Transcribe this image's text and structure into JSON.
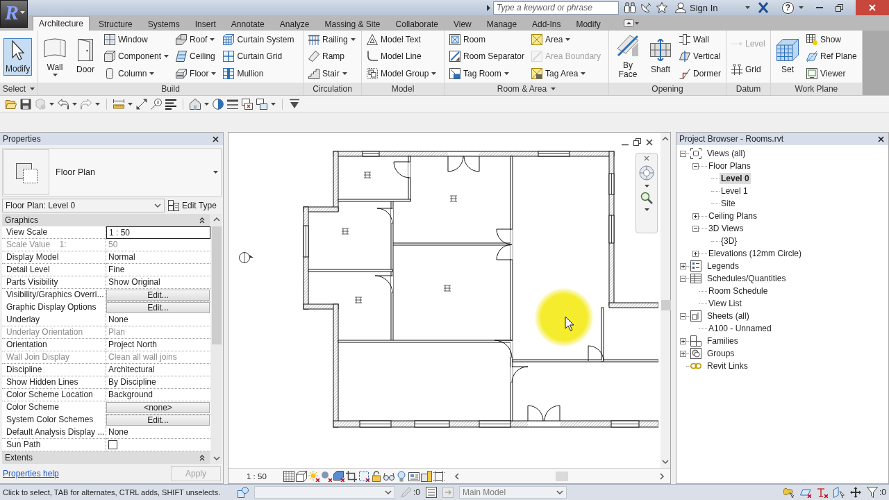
{
  "app_menu": {
    "logo": "R"
  },
  "title_bar": {
    "search": {
      "placeholder": "Type a keyword or phrase"
    },
    "sign_in": "Sign In",
    "help": "?"
  },
  "tabs": [
    {
      "label": "Architecture",
      "selected": true
    },
    {
      "label": "Structure",
      "selected": false
    },
    {
      "label": "Systems",
      "selected": false
    },
    {
      "label": "Insert",
      "selected": false
    },
    {
      "label": "Annotate",
      "selected": false
    },
    {
      "label": "Analyze",
      "selected": false
    },
    {
      "label": "Massing & Site",
      "selected": false
    },
    {
      "label": "Collaborate",
      "selected": false
    },
    {
      "label": "View",
      "selected": false
    },
    {
      "label": "Manage",
      "selected": false
    },
    {
      "label": "Add-Ins",
      "selected": false
    },
    {
      "label": "Modify",
      "selected": false
    }
  ],
  "ribbon": {
    "select": {
      "title": "Select",
      "menu": true,
      "tool": {
        "label": "Modify",
        "active": true
      }
    },
    "panels": [
      {
        "title": "Build",
        "menu": false,
        "columns": [
          [
            {
              "label": "Wall",
              "kind": "large",
              "dropdown": true,
              "disabled": false
            }
          ],
          [
            {
              "label": "Door",
              "kind": "large",
              "dropdown": false,
              "disabled": false
            }
          ],
          [
            {
              "label": "Window",
              "kind": "small",
              "dropdown": false,
              "disabled": false
            },
            {
              "label": "Component",
              "kind": "small",
              "dropdown": true,
              "disabled": false
            },
            {
              "label": "Column",
              "kind": "small",
              "dropdown": true,
              "disabled": false
            }
          ],
          [
            {
              "label": "Roof",
              "kind": "small",
              "dropdown": true,
              "disabled": false
            },
            {
              "label": "Ceiling",
              "kind": "small",
              "dropdown": false,
              "disabled": false
            },
            {
              "label": "Floor",
              "kind": "small",
              "dropdown": true,
              "disabled": false
            }
          ],
          [
            {
              "label": "Curtain System",
              "kind": "small",
              "dropdown": false,
              "disabled": false
            },
            {
              "label": "Curtain Grid",
              "kind": "small",
              "dropdown": false,
              "disabled": false
            },
            {
              "label": "Mullion",
              "kind": "small",
              "dropdown": false,
              "disabled": false
            }
          ]
        ]
      },
      {
        "title": "Circulation",
        "menu": false,
        "columns": [
          [
            {
              "label": "Railing",
              "kind": "small",
              "dropdown": true,
              "disabled": false
            },
            {
              "label": "Ramp",
              "kind": "small",
              "dropdown": false,
              "disabled": false
            },
            {
              "label": "Stair",
              "kind": "small",
              "dropdown": true,
              "disabled": false
            }
          ]
        ]
      },
      {
        "title": "Model",
        "menu": false,
        "columns": [
          [
            {
              "label": "Model Text",
              "kind": "small",
              "dropdown": false,
              "disabled": false
            },
            {
              "label": "Model Line",
              "kind": "small",
              "dropdown": false,
              "disabled": false
            },
            {
              "label": "Model Group",
              "kind": "small",
              "dropdown": true,
              "disabled": false
            }
          ]
        ]
      },
      {
        "title": "Room & Area",
        "menu": true,
        "columns": [
          [
            {
              "label": "Room",
              "kind": "small",
              "dropdown": false,
              "disabled": false
            },
            {
              "label": "Room Separator",
              "kind": "small",
              "dropdown": false,
              "disabled": false
            },
            {
              "label": "Tag Room",
              "kind": "small",
              "dropdown": true,
              "disabled": false
            }
          ],
          [
            {
              "label": "Area",
              "kind": "small",
              "dropdown": true,
              "disabled": false
            },
            {
              "label": "Area Boundary",
              "kind": "small",
              "dropdown": false,
              "disabled": true
            },
            {
              "label": "Tag Area",
              "kind": "small",
              "dropdown": true,
              "disabled": false
            }
          ]
        ]
      },
      {
        "title": "Opening",
        "menu": false,
        "columns": [
          [
            {
              "label": "By Face",
              "kind": "large",
              "dropdown": false,
              "disabled": false
            }
          ],
          [
            {
              "label": "Shaft",
              "kind": "large",
              "dropdown": false,
              "disabled": false
            }
          ],
          [
            {
              "label": "Wall",
              "kind": "small",
              "dropdown": false,
              "disabled": false
            },
            {
              "label": "Vertical",
              "kind": "small",
              "dropdown": false,
              "disabled": false
            },
            {
              "label": "Dormer",
              "kind": "small",
              "dropdown": false,
              "disabled": false
            }
          ]
        ]
      },
      {
        "title": "Datum",
        "menu": false,
        "columns": [
          [
            {
              "label": "Level",
              "kind": "small",
              "dropdown": false,
              "disabled": true
            },
            {
              "label": "Grid",
              "kind": "small",
              "dropdown": false,
              "disabled": false
            }
          ]
        ]
      },
      {
        "title": "Work Plane",
        "menu": false,
        "columns": [
          [
            {
              "label": "Set",
              "kind": "large",
              "dropdown": false,
              "disabled": false
            }
          ],
          [
            {
              "label": "Show",
              "kind": "small",
              "dropdown": false,
              "disabled": false
            },
            {
              "label": "Ref Plane",
              "kind": "small",
              "dropdown": false,
              "disabled": false
            },
            {
              "label": "Viewer",
              "kind": "small",
              "dropdown": false,
              "disabled": false
            }
          ]
        ]
      }
    ]
  },
  "properties": {
    "title": "Properties",
    "type": "Floor Plan",
    "instance": "Floor Plan: Level 0",
    "edit_type": "Edit Type",
    "groups": [
      {
        "title": "Graphics",
        "expanded": true,
        "rows": [
          {
            "name": "View Scale",
            "value": "1 : 50",
            "kind": "field",
            "disabled": false
          },
          {
            "name": "Scale Value    1:",
            "value": "50",
            "kind": "text",
            "disabled": true
          },
          {
            "name": "Display Model",
            "value": "Normal",
            "kind": "text",
            "disabled": false
          },
          {
            "name": "Detail Level",
            "value": "Fine",
            "kind": "text",
            "disabled": false
          },
          {
            "name": "Parts Visibility",
            "value": "Show Original",
            "kind": "text",
            "disabled": false
          },
          {
            "name": "Visibility/Graphics Overri...",
            "value": "Edit...",
            "kind": "button",
            "disabled": false
          },
          {
            "name": "Graphic Display Options",
            "value": "Edit...",
            "kind": "button",
            "disabled": false
          },
          {
            "name": "Underlay",
            "value": "None",
            "kind": "text",
            "disabled": false
          },
          {
            "name": "Underlay Orientation",
            "value": "Plan",
            "kind": "text",
            "disabled": true
          },
          {
            "name": "Orientation",
            "value": "Project North",
            "kind": "text",
            "disabled": false
          },
          {
            "name": "Wall Join Display",
            "value": "Clean all wall joins",
            "kind": "text",
            "disabled": true
          },
          {
            "name": "Discipline",
            "value": "Architectural",
            "kind": "text",
            "disabled": false
          },
          {
            "name": "Show Hidden Lines",
            "value": "By Discipline",
            "kind": "text",
            "disabled": false
          },
          {
            "name": "Color Scheme Location",
            "value": "Background",
            "kind": "text",
            "disabled": false
          },
          {
            "name": "Color Scheme",
            "value": "<none>",
            "kind": "button",
            "disabled": false
          },
          {
            "name": "System Color Schemes",
            "value": "Edit...",
            "kind": "button",
            "disabled": false
          },
          {
            "name": "Default Analysis Display ...",
            "value": "None",
            "kind": "text",
            "disabled": false
          },
          {
            "name": "Sun Path",
            "kind": "checkbox",
            "checked": false,
            "disabled": false
          }
        ]
      },
      {
        "title": "Extents",
        "expanded": true
      }
    ],
    "help": "Properties help",
    "apply": {
      "label": "Apply",
      "disabled": true
    }
  },
  "view": {
    "scale": "1 : 50"
  },
  "project_browser": {
    "title": "Project Browser - Rooms.rvt",
    "tree": [
      {
        "label": "Views (all)",
        "expanded": true,
        "selected": false,
        "children": [
          {
            "label": "Floor Plans",
            "expanded": true,
            "selected": false,
            "children": [
              {
                "label": "Level 0",
                "selected": true
              },
              {
                "label": "Level 1",
                "selected": false
              },
              {
                "label": "Site",
                "selected": false
              }
            ]
          },
          {
            "label": "Ceiling Plans",
            "expanded": false,
            "selected": false
          },
          {
            "label": "3D Views",
            "expanded": true,
            "selected": false,
            "children": [
              {
                "label": "{3D}",
                "selected": false
              }
            ]
          },
          {
            "label": "Elevations (12mm Circle)",
            "expanded": false,
            "selected": false
          }
        ]
      },
      {
        "label": "Legends",
        "expanded": false,
        "selected": false
      },
      {
        "label": "Schedules/Quantities",
        "expanded": true,
        "selected": false,
        "children": [
          {
            "label": "Room Schedule",
            "selected": false
          },
          {
            "label": "View List",
            "selected": false
          }
        ]
      },
      {
        "label": "Sheets (all)",
        "expanded": true,
        "selected": false,
        "children": [
          {
            "label": "A100 - Unnamed",
            "selected": false
          }
        ]
      },
      {
        "label": "Families",
        "expanded": false,
        "selected": false
      },
      {
        "label": "Groups",
        "expanded": false,
        "selected": false
      },
      {
        "label": "Revit Links",
        "selected": false
      }
    ]
  },
  "status_bar": {
    "message": "Click to select, TAB for alternates, CTRL adds, SHIFT unselects.",
    "editable_count": ":0",
    "model": {
      "value": "Main Model",
      "disabled": true
    },
    "filter_count": ":0"
  }
}
